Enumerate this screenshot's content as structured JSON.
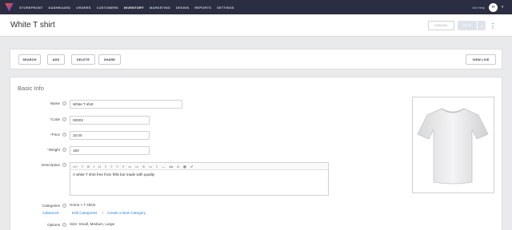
{
  "nav": {
    "items": [
      "STOREFRONT",
      "DASHBOARD",
      "ORDERS",
      "CUSTOMERS",
      "INVENTORY",
      "MARKETING",
      "DESIGN",
      "REPORTS",
      "SETTINGS"
    ],
    "active": "INVENTORY",
    "get_help": "Get Help",
    "avatar_initials": "TF"
  },
  "header": {
    "title": "White T shirt",
    "cancel_label": "CANCEL",
    "save_label": "SAVE"
  },
  "actions": {
    "search": "SEARCH",
    "add": "ADD",
    "delete": "DELETE",
    "share": "SHARE",
    "view_live": "VIEW LIVE"
  },
  "basic_info": {
    "title": "Basic Info",
    "name_label": "Name",
    "name_value": "White T shirt",
    "code_label": "Code",
    "code_value": "00003",
    "price_label": "Price",
    "price_value": "10.00",
    "weight_label": "Weight",
    "weight_value": "150",
    "description_label": "Description",
    "description_value": "A white T shirt free from frills but made with quality",
    "categories_label": "Categories",
    "categories_value": "Home > T shirts",
    "advanced_link": "Advanced",
    "edit_categories_link": "Edit Categories",
    "separator": "/",
    "create_category_link": "Create a New Category",
    "options_label": "Options",
    "options_value": "Size: Small, Medium, Large"
  },
  "toolbar_icons": [
    "</>",
    "T",
    "B",
    "I",
    "U",
    "≡",
    "≡",
    "≡",
    "≡",
    "▭",
    "▭",
    "⊙",
    "▭",
    "≡",
    "—",
    "Aa",
    "A",
    "▦",
    "x²"
  ],
  "colors": {
    "nav_bg": "#2b2d42",
    "link": "#2d7fd6",
    "required": "#d9534f"
  }
}
